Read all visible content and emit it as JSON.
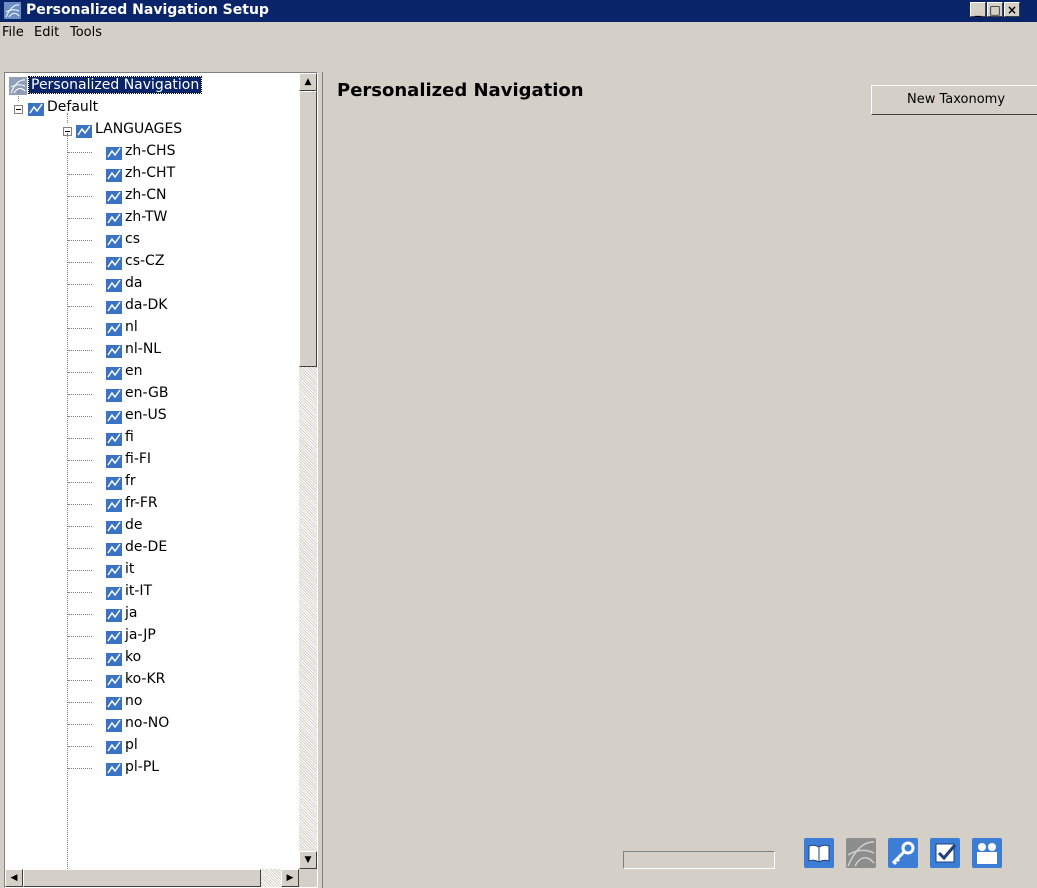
{
  "window": {
    "title": "Personalized Navigation Setup"
  },
  "menu": {
    "items": [
      "File",
      "Edit",
      "Tools"
    ]
  },
  "tree": {
    "root": "Personalized Navigation",
    "default": "Default",
    "languages": "LANGUAGES",
    "items": [
      "zh-CHS",
      "zh-CHT",
      "zh-CN",
      "zh-TW",
      "cs",
      "cs-CZ",
      "da",
      "da-DK",
      "nl",
      "nl-NL",
      "en",
      "en-GB",
      "en-US",
      "fi",
      "fi-FI",
      "fr",
      "fr-FR",
      "de",
      "de-DE",
      "it",
      "it-IT",
      "ja",
      "ja-JP",
      "ko",
      "ko-KR",
      "no",
      "no-NO",
      "pl",
      "pl-PL"
    ]
  },
  "content": {
    "heading": "Personalized Navigation",
    "new_taxonomy": "New Taxonomy"
  },
  "toolbar": {
    "icons": [
      "book-icon",
      "globe-icon",
      "key-icon",
      "checklist-icon",
      "users-icon"
    ]
  }
}
